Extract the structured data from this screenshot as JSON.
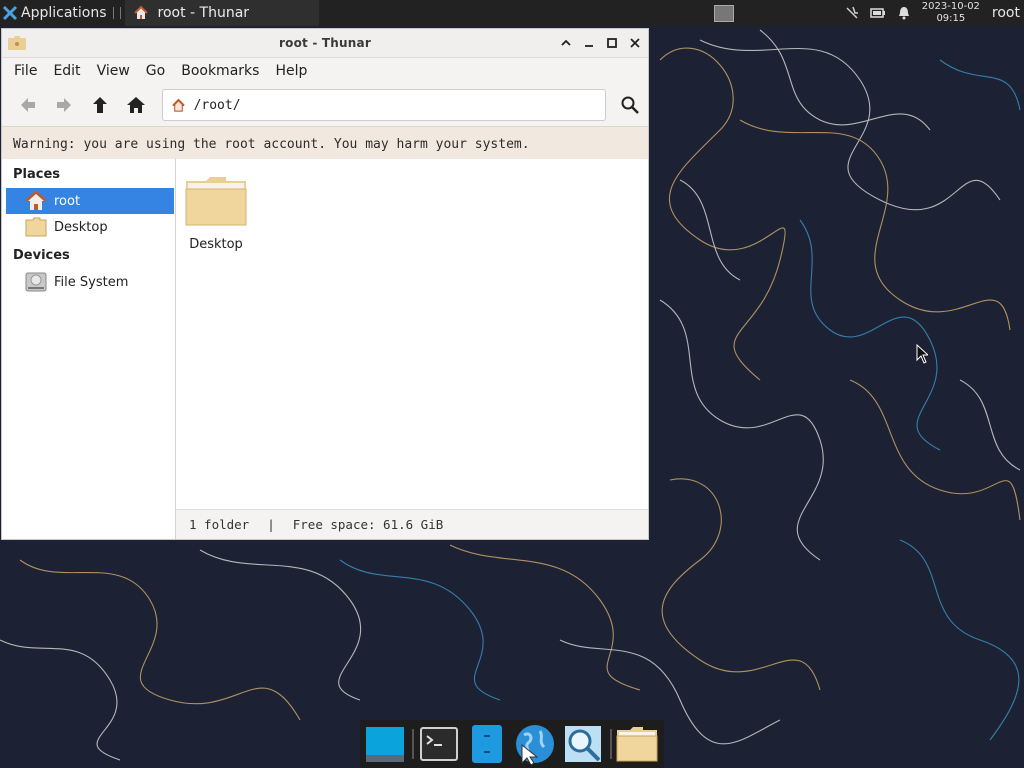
{
  "panel": {
    "applications_label": "Applications",
    "task_label": "root - Thunar",
    "clock_date": "2023-10-02",
    "clock_time": "09:15",
    "user": "root"
  },
  "window": {
    "title": "root - Thunar",
    "menu": [
      "File",
      "Edit",
      "View",
      "Go",
      "Bookmarks",
      "Help"
    ],
    "location_path": "/root/",
    "warning": "Warning: you are using the root account. You may harm your system.",
    "sidebar": {
      "places_header": "Places",
      "places": [
        "root",
        "Desktop"
      ],
      "devices_header": "Devices",
      "devices": [
        "File System"
      ]
    },
    "items": [
      {
        "name": "Desktop",
        "type": "folder"
      }
    ],
    "status": {
      "count": "1 folder",
      "separator": "|",
      "free_space": "Free space: 61.6 GiB"
    }
  },
  "colors": {
    "selection": "#3584e4",
    "warning_bg": "#f1e8df",
    "folder": "#f0d59c",
    "desktop_bg": "#1c2233"
  },
  "dock": {
    "items": [
      "show-desktop-icon",
      "terminal-icon",
      "file-manager-icon",
      "web-browser-icon",
      "app-finder-icon",
      "folder-icon"
    ]
  }
}
